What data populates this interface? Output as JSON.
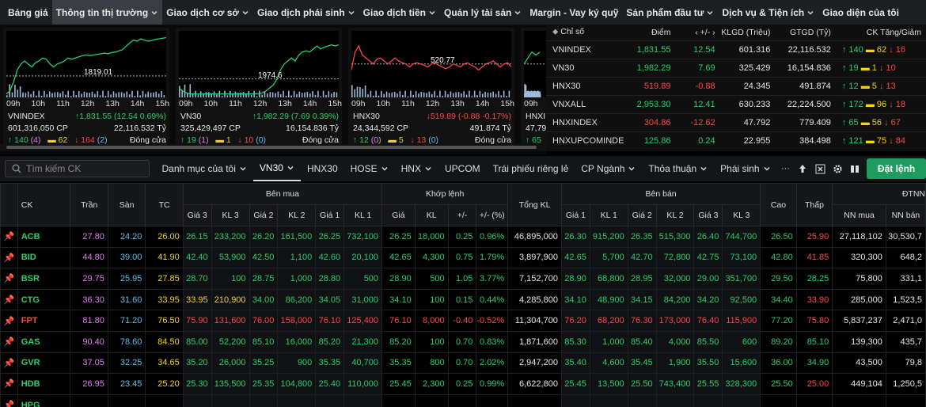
{
  "nav": {
    "items": [
      {
        "label": "Bảng giá",
        "dropdown": false
      },
      {
        "label": "Thông tin thị trường",
        "dropdown": true,
        "active": true
      },
      {
        "label": "Giao dịch cơ sở",
        "dropdown": true
      },
      {
        "label": "Giao dịch phái sinh",
        "dropdown": true
      },
      {
        "label": "Giao dịch tiền",
        "dropdown": true
      },
      {
        "label": "Quản lý tài sản",
        "dropdown": true
      },
      {
        "label": "Margin - Vay ký quỹ",
        "dropdown": false
      },
      {
        "label": "Sản phẩm đầu tư",
        "dropdown": true
      },
      {
        "label": "Dịch vụ & Tiện ích",
        "dropdown": true
      },
      {
        "label": "Giao diện của tôi",
        "dropdown": false
      }
    ]
  },
  "mini_charts": [
    {
      "name": "VNINDEX",
      "ref_label": "1819.01",
      "value_text": "1,831.55 (12.54 0.69%)",
      "direction": "up",
      "volume": "601,316,050 CP",
      "turnover": "22,116.532 Tỷ",
      "up_count": "140",
      "up_ce": "(4)",
      "ref_count": "62",
      "down_count": "164",
      "down_fl": "(2)",
      "status": "Đóng cửa",
      "times": [
        "09h",
        "10h",
        "11h",
        "12h",
        "13h",
        "14h",
        "15h"
      ],
      "series": [
        1.0,
        0.95,
        0.8,
        0.6,
        0.5,
        0.45,
        0.5,
        0.55,
        0.48,
        0.45,
        0.4,
        0.42,
        0.5,
        0.55,
        0.5,
        0.48,
        0.45,
        0.4,
        0.42,
        0.4,
        0.38,
        0.36,
        0.35,
        0.36,
        0.35,
        0.34,
        0.33,
        0.32,
        0.33,
        0.31,
        0.3,
        0.28,
        0.26,
        0.2,
        0.15,
        0.1,
        0.12,
        0.08,
        0.1,
        0.12,
        0.11,
        0.09,
        0.08,
        0.07,
        0.06
      ],
      "ref_level": 0.7
    },
    {
      "name": "VN30",
      "ref_label": "1974.6",
      "value_text": "1,982.29 (7.69 0.39%)",
      "direction": "up",
      "volume": "325,429,497 CP",
      "turnover": "16,154.836 Tỷ",
      "up_count": "19",
      "up_ce": "(1)",
      "ref_count": "1",
      "down_count": "10",
      "down_fl": "(0)",
      "status": "Đóng cửa",
      "times": [
        "09h",
        "10h",
        "11h",
        "12h",
        "13h",
        "14h",
        "15h"
      ],
      "series": [
        0.9,
        0.95,
        0.98,
        1.0,
        1.0,
        1.0,
        1.0,
        1.0,
        1.0,
        1.0,
        1.0,
        1.0,
        1.0,
        1.0,
        1.0,
        1.0,
        1.0,
        1.0,
        1.0,
        1.0,
        1.0,
        1.0,
        1.0,
        0.98,
        0.95,
        0.9,
        0.85,
        0.75,
        0.6,
        0.5,
        0.45,
        0.4,
        0.45,
        0.35,
        0.3,
        0.28,
        0.3,
        0.25,
        0.2,
        0.25,
        0.22,
        0.2,
        0.18,
        0.2,
        0.18
      ],
      "ref_level": 0.75
    },
    {
      "name": "HNX30",
      "ref_label": "520.77",
      "value_text": "519.89 (-0.88 -0.17%)",
      "direction": "down",
      "volume": "24,344,592 CP",
      "turnover": "491.874 Tỷ",
      "up_count": "12",
      "up_ce": "(0)",
      "ref_count": "5",
      "down_count": "13",
      "down_fl": "(0)",
      "status": "Đóng cửa",
      "times": [
        "09h",
        "10h",
        "11h",
        "12h",
        "13h",
        "14h",
        "15h"
      ],
      "series": [
        0.6,
        0.3,
        0.2,
        0.35,
        0.4,
        0.45,
        0.5,
        0.42,
        0.4,
        0.45,
        0.5,
        0.45,
        0.4,
        0.45,
        0.48,
        0.5,
        0.55,
        0.5,
        0.48,
        0.5,
        0.52,
        0.55,
        0.5,
        0.48,
        0.52,
        0.55,
        0.58,
        0.55,
        0.5,
        0.52,
        0.55,
        0.5,
        0.48,
        0.52,
        0.55,
        0.6,
        0.55,
        0.5,
        0.48,
        0.45,
        0.5,
        0.55,
        0.5,
        0.48,
        0.55
      ],
      "ref_level": 0.5
    },
    {
      "name": "HNXI",
      "ref_label": "",
      "value_text": "",
      "direction": "up",
      "volume": "47,79",
      "turnover": "",
      "up_count": "65",
      "up_ce": "",
      "ref_count": "",
      "down_count": "",
      "down_fl": "",
      "status": "",
      "times": [
        "09h"
      ],
      "series": [
        0.5,
        0.4,
        0.3,
        0.35,
        0.3
      ],
      "ref_level": 0.5
    }
  ],
  "index_table": {
    "headers": [
      "Chỉ số",
      "Điểm",
      "+/-",
      "KLGD (Triệu)",
      "GTGD (Tỷ)",
      "CK Tăng/Giảm"
    ],
    "rows": [
      {
        "name": "VNINDEX",
        "point": "1,831.55",
        "change": "12.54",
        "vol": "601.316",
        "val": "22,116.532",
        "up": "140",
        "ref": "62",
        "down": "16",
        "dir": "up"
      },
      {
        "name": "VN30",
        "point": "1,982.29",
        "change": "7.69",
        "vol": "325.429",
        "val": "16,154.836",
        "up": "19",
        "ref": "1",
        "down": "10",
        "dir": "up"
      },
      {
        "name": "HNX30",
        "point": "519.89",
        "change": "-0.88",
        "vol": "24.345",
        "val": "491.874",
        "up": "12",
        "ref": "5",
        "down": "13",
        "dir": "down"
      },
      {
        "name": "VNXALL",
        "point": "2,953.30",
        "change": "12.41",
        "vol": "630.233",
        "val": "22,224.500",
        "up": "172",
        "ref": "96",
        "down": "18",
        "dir": "up"
      },
      {
        "name": "HNXINDEX",
        "point": "304.86",
        "change": "-12.62",
        "vol": "47.792",
        "val": "779.409",
        "up": "65",
        "ref": "56",
        "down": "67",
        "dir": "down"
      },
      {
        "name": "HNXUPCOMINDE",
        "point": "125.86",
        "change": "0.24",
        "vol": "22.955",
        "val": "384.498",
        "up": "121",
        "ref": "75",
        "down": "84",
        "dir": "up"
      }
    ]
  },
  "toolbar": {
    "search_placeholder": "Tìm kiếm CK",
    "tabs": [
      {
        "label": "Danh mục của tôi",
        "dropdown": true
      },
      {
        "label": "VN30",
        "dropdown": true,
        "active": true
      },
      {
        "label": "HNX30",
        "dropdown": false
      },
      {
        "label": "HOSE",
        "dropdown": true
      },
      {
        "label": "HNX",
        "dropdown": true
      },
      {
        "label": "UPCOM",
        "dropdown": false
      },
      {
        "label": "Trái phiếu riêng lẻ",
        "dropdown": false
      },
      {
        "label": "CP Ngành",
        "dropdown": true
      },
      {
        "label": "Thỏa thuận",
        "dropdown": true
      },
      {
        "label": "Phái sinh",
        "dropdown": true
      }
    ],
    "more": "···",
    "trade_label": "Đặt lệnh"
  },
  "board": {
    "group_headers": {
      "ck": "CK",
      "ceil": "Trần",
      "floor": "Sàn",
      "ref": "TC",
      "buy": "Bên mua",
      "match": "Khớp lệnh",
      "total": "Tổng KL",
      "sell": "Bên bán",
      "high": "Cao",
      "low": "Thấp",
      "foreign": "ĐTNN"
    },
    "sub_headers": {
      "buy": [
        "Giá 3",
        "KL 3",
        "Giá 2",
        "KL 2",
        "Giá 1",
        "KL 1"
      ],
      "match": [
        "Giá",
        "KL",
        "+/-",
        "+/- (%)"
      ],
      "sell": [
        "Giá 1",
        "KL 1",
        "Giá 2",
        "KL 2",
        "Giá 3",
        "KL 3"
      ],
      "foreign": [
        "NN mua",
        "NN bán"
      ]
    },
    "rows": [
      {
        "ck": "ACB",
        "c": "up",
        "ceil": "27.80",
        "floor": "24.20",
        "ref": "26.00",
        "b3": "26.15",
        "bk3": "233,200",
        "b2": "26.20",
        "bk2": "161,500",
        "b1": "26.25",
        "bk1": "732,100",
        "mp": "26.25",
        "mk": "18,000",
        "ch": "0.25",
        "pct": "0.96%",
        "tot": "46,895,000",
        "s1": "26.30",
        "sk1": "915,200",
        "s2": "26.35",
        "sk2": "515,300",
        "s3": "26.40",
        "sk3": "744,700",
        "hi": "26.50",
        "lo": "25.90",
        "nnm": "27,118,102",
        "nnb": "30,530,7",
        "cb3": "up",
        "cb2": "up",
        "cb1": "up",
        "cs1": "up",
        "cs2": "up",
        "cs3": "up",
        "chi": "up",
        "clo": "dn"
      },
      {
        "ck": "BID",
        "c": "up",
        "ceil": "44.80",
        "floor": "39.00",
        "ref": "41.90",
        "b3": "42.40",
        "bk3": "53,900",
        "b2": "42.50",
        "bk2": "1,100",
        "b1": "42.60",
        "bk1": "20,100",
        "mp": "42.65",
        "mk": "4,300",
        "ch": "0.75",
        "pct": "1.79%",
        "tot": "3,897,900",
        "s1": "42.65",
        "sk1": "5,700",
        "s2": "42.70",
        "sk2": "72,800",
        "s3": "42.75",
        "sk3": "73,100",
        "hi": "42.80",
        "lo": "41.85",
        "nnm": "320,300",
        "nnb": "648,2",
        "cb3": "up",
        "cb2": "up",
        "cb1": "up",
        "cs1": "up",
        "cs2": "up",
        "cs3": "up",
        "chi": "up",
        "clo": "dn"
      },
      {
        "ck": "BSR",
        "c": "up",
        "ceil": "29.75",
        "floor": "25.95",
        "ref": "27.85",
        "b3": "28.70",
        "bk3": "100",
        "b2": "28.75",
        "bk2": "1,000",
        "b1": "28.80",
        "bk1": "500",
        "mp": "28.90",
        "mk": "500",
        "ch": "1.05",
        "pct": "3.77%",
        "tot": "7,152,700",
        "s1": "28.90",
        "sk1": "68,800",
        "s2": "28.95",
        "sk2": "32,000",
        "s3": "29.00",
        "sk3": "351,700",
        "hi": "29.50",
        "lo": "28.25",
        "nnm": "75,800",
        "nnb": "331,1",
        "cb3": "up",
        "cb2": "up",
        "cb1": "up",
        "cs1": "up",
        "cs2": "up",
        "cs3": "up",
        "chi": "up",
        "clo": "up"
      },
      {
        "ck": "CTG",
        "c": "up",
        "ceil": "36.30",
        "floor": "31.60",
        "ref": "33.95",
        "b3": "33.95",
        "bk3": "210,900",
        "b2": "34.00",
        "bk2": "86,200",
        "b1": "34.05",
        "bk1": "31,000",
        "mp": "34.10",
        "mk": "100",
        "ch": "0.15",
        "pct": "0.44%",
        "tot": "4,285,800",
        "s1": "34.10",
        "sk1": "48,900",
        "s2": "34.15",
        "sk2": "84,200",
        "s3": "34.20",
        "sk3": "92,500",
        "hi": "34.40",
        "lo": "33.90",
        "nnm": "285,000",
        "nnb": "1,523,5",
        "cb3": "ref",
        "cb2": "up",
        "cb1": "up",
        "cs1": "up",
        "cs2": "up",
        "cs3": "up",
        "chi": "up",
        "clo": "dn"
      },
      {
        "ck": "FPT",
        "c": "dn",
        "ceil": "81.80",
        "floor": "71.20",
        "ref": "76.50",
        "b3": "75.90",
        "bk3": "131,600",
        "b2": "76.00",
        "bk2": "158,000",
        "b1": "76.10",
        "bk1": "125,400",
        "mp": "76.10",
        "mk": "8,000",
        "ch": "-0.40",
        "pct": "-0.52%",
        "tot": "11,304,700",
        "s1": "76.20",
        "sk1": "68,200",
        "s2": "76.30",
        "sk2": "173,000",
        "s3": "76.40",
        "sk3": "115,900",
        "hi": "77.20",
        "lo": "75.80",
        "nnm": "5,837,237",
        "nnb": "2,471,0",
        "cb3": "dn",
        "cb2": "dn",
        "cb1": "dn",
        "cs1": "dn",
        "cs2": "dn",
        "cs3": "dn",
        "chi": "up",
        "clo": "dn"
      },
      {
        "ck": "GAS",
        "c": "up",
        "ceil": "90.40",
        "floor": "78.60",
        "ref": "84.50",
        "b3": "85.00",
        "bk3": "52,200",
        "b2": "85.10",
        "bk2": "16,000",
        "b1": "85.20",
        "bk1": "21,300",
        "mp": "85.20",
        "mk": "100",
        "ch": "0.70",
        "pct": "0.83%",
        "tot": "1,871,600",
        "s1": "85.30",
        "sk1": "1,000",
        "s2": "85.40",
        "sk2": "4,000",
        "s3": "85.50",
        "sk3": "600",
        "hi": "89.20",
        "lo": "85.10",
        "nnm": "139,300",
        "nnb": "435,7",
        "cb3": "up",
        "cb2": "up",
        "cb1": "up",
        "cs1": "up",
        "cs2": "up",
        "cs3": "up",
        "chi": "up",
        "clo": "up"
      },
      {
        "ck": "GVR",
        "c": "up",
        "ceil": "37.05",
        "floor": "32.25",
        "ref": "34.65",
        "b3": "35.20",
        "bk3": "26,000",
        "b2": "35.25",
        "bk2": "900",
        "b1": "35.35",
        "bk1": "40,700",
        "mp": "35.35",
        "mk": "800",
        "ch": "0.70",
        "pct": "2.02%",
        "tot": "2,947,200",
        "s1": "35.40",
        "sk1": "4,600",
        "s2": "35.45",
        "sk2": "1,900",
        "s3": "35.50",
        "sk3": "15,600",
        "hi": "36.00",
        "lo": "34.90",
        "nnm": "43,500",
        "nnb": "79,8",
        "cb3": "up",
        "cb2": "up",
        "cb1": "up",
        "cs1": "up",
        "cs2": "up",
        "cs3": "up",
        "chi": "up",
        "clo": "up"
      },
      {
        "ck": "HDB",
        "c": "up",
        "ceil": "26.95",
        "floor": "23.45",
        "ref": "25.20",
        "b3": "25.30",
        "bk3": "135,500",
        "b2": "25.35",
        "bk2": "104,800",
        "b1": "25.40",
        "bk1": "110,000",
        "mp": "25.45",
        "mk": "2,300",
        "ch": "0.25",
        "pct": "0.99%",
        "tot": "6,622,800",
        "s1": "25.45",
        "sk1": "13,500",
        "s2": "25.50",
        "sk2": "743,400",
        "s3": "25.55",
        "sk3": "328,300",
        "hi": "25.50",
        "lo": "25.00",
        "nnm": "449,104",
        "nnb": "1,250,5",
        "cb3": "up",
        "cb2": "up",
        "cb1": "up",
        "cs1": "up",
        "cs2": "up",
        "cs3": "up",
        "chi": "up",
        "clo": "dn"
      },
      {
        "ck": "HPG",
        "c": "up",
        "ceil": "",
        "floor": "",
        "ref": "",
        "b3": "",
        "bk3": "",
        "b2": "",
        "bk2": "",
        "b1": "",
        "bk1": "",
        "mp": "",
        "mk": "",
        "ch": "",
        "pct": "",
        "tot": "",
        "s1": "",
        "sk1": "",
        "s2": "",
        "sk2": "",
        "s3": "",
        "sk3": "",
        "hi": "",
        "lo": "",
        "nnm": "",
        "nnb": "",
        "cb3": "up",
        "cb2": "up",
        "cb1": "up",
        "cs1": "up",
        "cs2": "up",
        "cs3": "up",
        "chi": "up",
        "clo": "up"
      }
    ]
  },
  "colors": {
    "up": "#24d06c",
    "down": "#ff4646",
    "ref": "#f4d600",
    "ceil": "#e27cf4",
    "floor": "#5bc0ee",
    "accent": "#1e9b5e"
  }
}
